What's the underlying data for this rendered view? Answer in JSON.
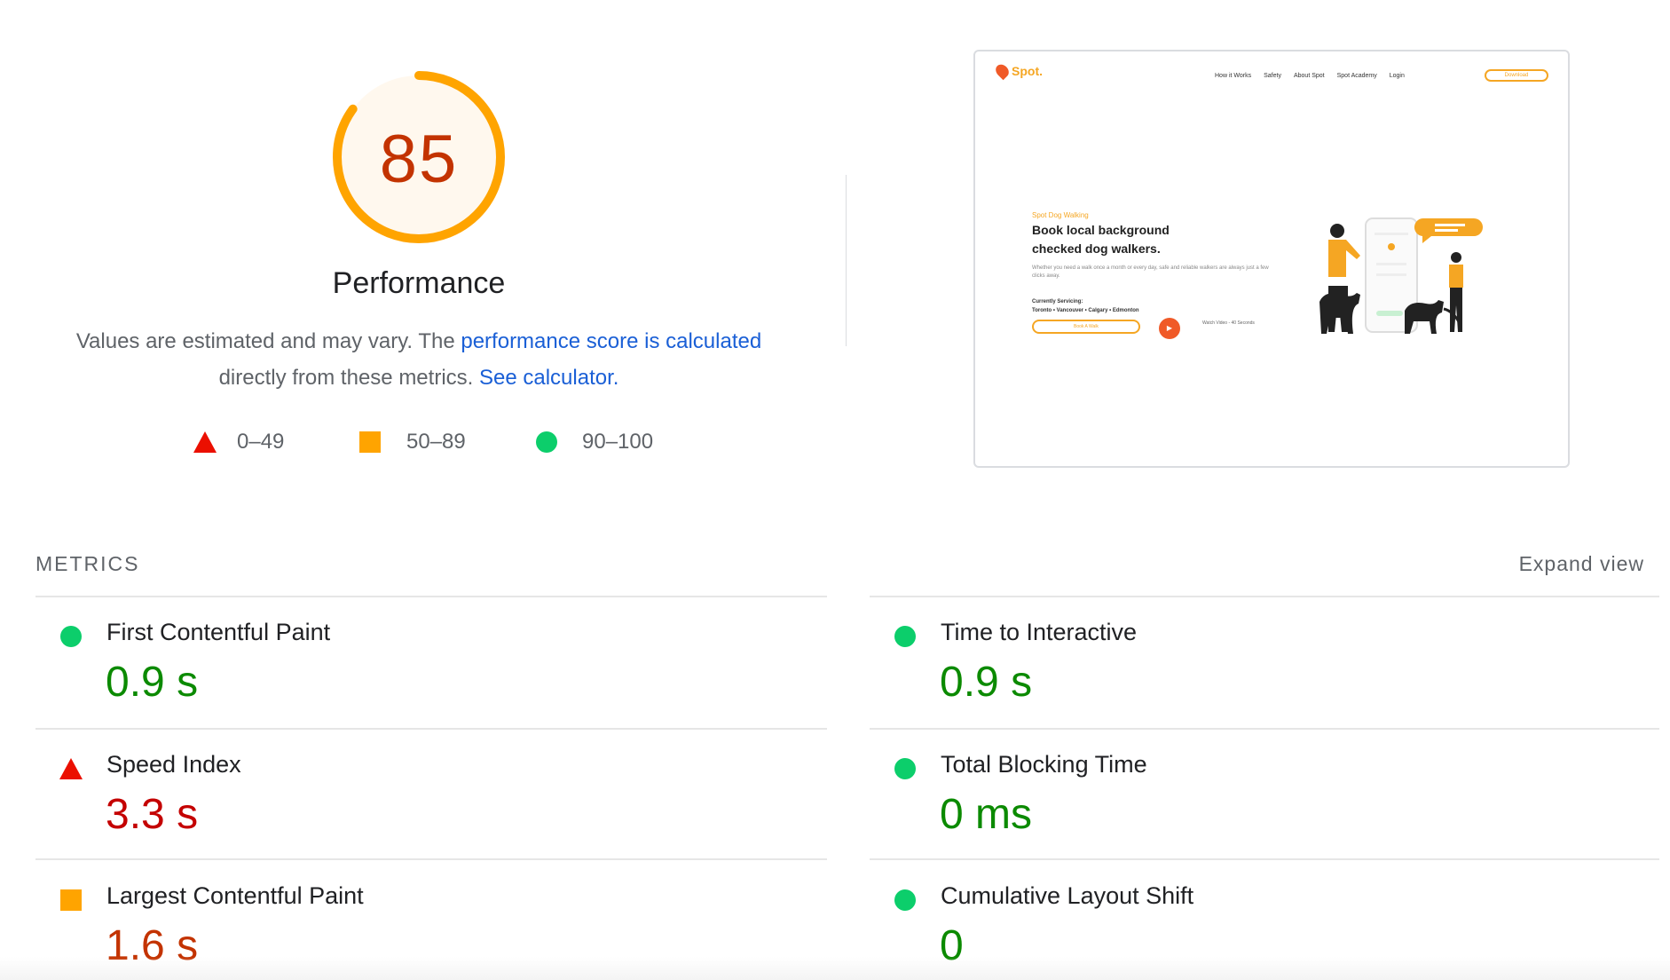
{
  "score": {
    "value": 85,
    "fraction": 0.85,
    "title": "Performance",
    "color": "#ffa400",
    "fill": "#fff8ee",
    "text_color": "#c33300"
  },
  "explanation": {
    "part1": "Values are estimated and may vary. The ",
    "link1": "performance score is calculated",
    "part2": " directly from these metrics. ",
    "link2": "See calculator."
  },
  "legend": [
    {
      "label": "0–49",
      "icon": "triangle-icon",
      "color": "#eb0f00"
    },
    {
      "label": "50–89",
      "icon": "square-icon",
      "color": "#ffa400"
    },
    {
      "label": "90–100",
      "icon": "circle-icon",
      "color": "#0cce6b"
    }
  ],
  "thumbnail": {
    "logo": "Spot.",
    "nav": [
      "How it Works",
      "Safety",
      "About Spot",
      "Spot Academy",
      "Login"
    ],
    "download": "Download",
    "kicker": "Spot Dog Walking",
    "headline": "Book local background checked dog walkers.",
    "subtext": "Whether you need a walk once a month or every day, safe and reliable walkers are always just a few clicks away.",
    "servicing_label": "Currently Servicing:",
    "servicing_cities": "Toronto • Vancouver • Calgary • Edmonton",
    "cta": "Book A Walk",
    "watch": "Watch Video - 40 Seconds"
  },
  "metrics_header": {
    "title": "METRICS",
    "expand": "Expand view"
  },
  "metrics": [
    {
      "name": "First Contentful Paint",
      "value": "0.9 s",
      "rating": "good",
      "icon": "circle-icon"
    },
    {
      "name": "Time to Interactive",
      "value": "0.9 s",
      "rating": "good",
      "icon": "circle-icon"
    },
    {
      "name": "Speed Index",
      "value": "3.3 s",
      "rating": "bad",
      "icon": "triangle-icon"
    },
    {
      "name": "Total Blocking Time",
      "value": "0 ms",
      "rating": "good",
      "icon": "circle-icon"
    },
    {
      "name": "Largest Contentful Paint",
      "value": "1.6 s",
      "rating": "avg",
      "icon": "square-icon"
    },
    {
      "name": "Cumulative Layout Shift",
      "value": "0",
      "rating": "good",
      "icon": "circle-icon"
    }
  ]
}
